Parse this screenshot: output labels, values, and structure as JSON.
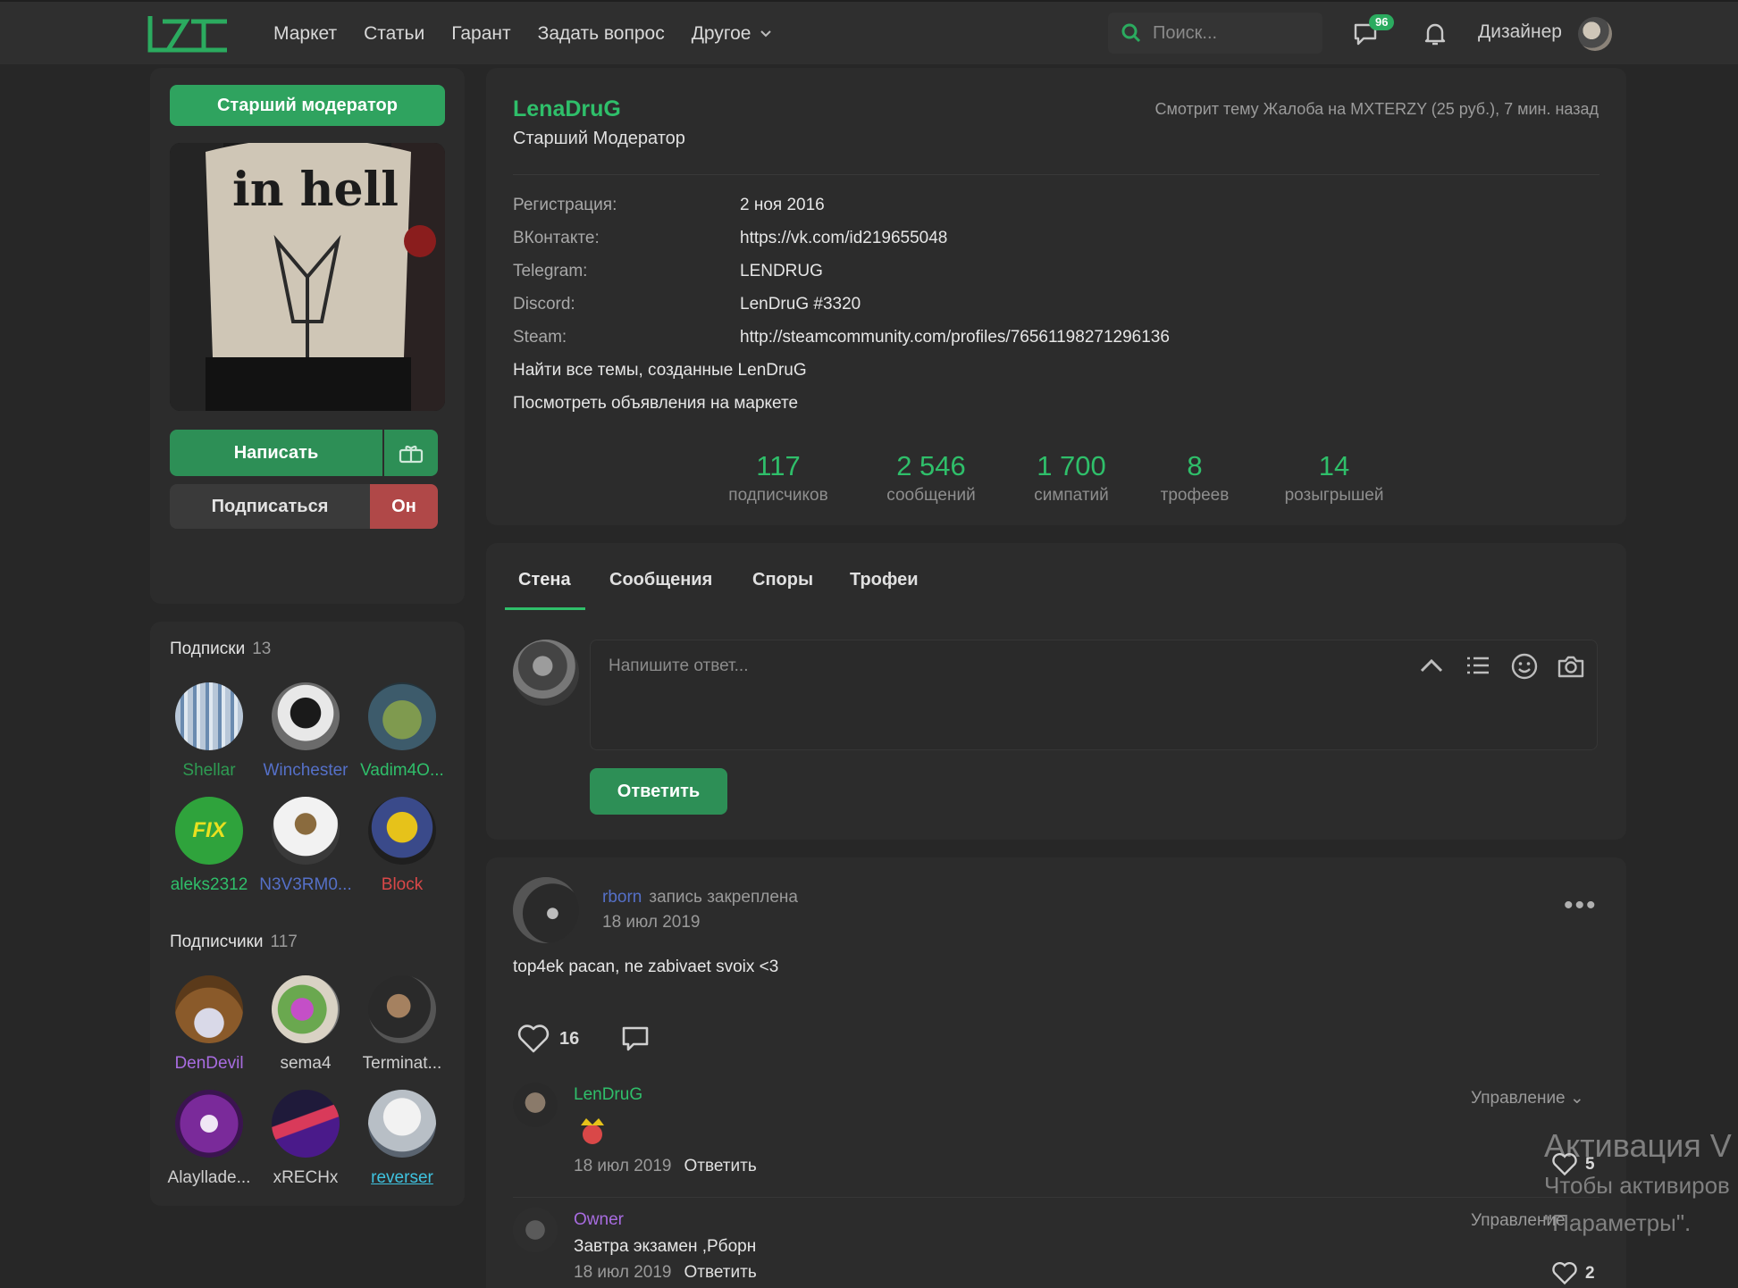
{
  "nav": {
    "links": [
      "Маркет",
      "Статьи",
      "Гарант",
      "Задать вопрос",
      "Другое"
    ],
    "search_placeholder": "Поиск...",
    "messages_badge": "96",
    "user_name": "Дизайнер",
    "colors": {
      "accent": "#2fbf6a",
      "bg": "#272727",
      "panel": "#2c2c2c"
    }
  },
  "sidebar": {
    "role_badge": "Старший модератор",
    "write_label": "Написать",
    "follow_label": "Подписаться",
    "gender_label": "Он",
    "subscriptions": {
      "title": "Подписки",
      "count": "13",
      "users": [
        {
          "name": "Shellar",
          "color": "#2e9b52"
        },
        {
          "name": "Winchester",
          "color": "#5570c8"
        },
        {
          "name": "Vadim4O...",
          "color": "#2fbf6a"
        },
        {
          "name": "aleks2312",
          "color": "#2fbf6a"
        },
        {
          "name": "N3V3RM0...",
          "color": "#5570c8"
        },
        {
          "name": "Block",
          "color": "#d94848"
        }
      ]
    },
    "followers": {
      "title": "Подписчики",
      "count": "117",
      "users": [
        {
          "name": "DenDevil",
          "color": "#a86ce0"
        },
        {
          "name": "sema4",
          "color": "#cfcfcf"
        },
        {
          "name": "Terminat...",
          "color": "#cfcfcf"
        },
        {
          "name": "Alaylladе...",
          "color": "#cfcfcf"
        },
        {
          "name": "xRECHx",
          "color": "#cfcfcf"
        },
        {
          "name": "reverser",
          "color": "#3fc3e0"
        }
      ]
    }
  },
  "profile": {
    "name": "LenaDruG",
    "role": "Старший Модератор",
    "status": "Смотрит тему Жалоба на MXTERZY (25 руб.), 7 мин. назад",
    "info": [
      {
        "label": "Регистрация:",
        "value": "2 ноя 2016"
      },
      {
        "label": "ВКонтакте:",
        "value": "https://vk.com/id219655048"
      },
      {
        "label": "Telegram:",
        "value": "LENDRUG"
      },
      {
        "label": "Discord:",
        "value": "LenDruG #3320"
      },
      {
        "label": "Steam:",
        "value": "http://steamcommunity.com/profiles/76561198271296136"
      }
    ],
    "links": [
      "Найти все темы, созданные LenDruG",
      "Посмотреть объявления на маркете"
    ],
    "stats": [
      {
        "value": "117",
        "label": "подписчиков"
      },
      {
        "value": "2 546",
        "label": "сообщений"
      },
      {
        "value": "1 700",
        "label": "симпатий"
      },
      {
        "value": "8",
        "label": "трофеев"
      },
      {
        "value": "14",
        "label": "розыгрышей"
      }
    ]
  },
  "tabs": [
    "Стена",
    "Сообщения",
    "Споры",
    "Трофеи"
  ],
  "reply": {
    "placeholder": "Напишите ответ...",
    "button": "Ответить"
  },
  "post": {
    "author": "rborn",
    "action": "запись закреплена",
    "date": "18 июл 2019",
    "text": "top4ek pacan, ne zabivaet svoix <3",
    "likes": "16",
    "comments": [
      {
        "author": "LenDruG",
        "date": "18 июл 2019",
        "reply": "Ответить",
        "manage": "Управление",
        "likes": "5",
        "text": ""
      },
      {
        "author": "Owner",
        "date": "18 июл 2019",
        "reply": "Ответить",
        "manage": "Управление",
        "likes": "2",
        "text": "Завтра экзамен ,Рборн"
      }
    ]
  },
  "watermark": {
    "line1": "Активация V",
    "line2": "Чтобы активиров",
    "line3": "\"Параметры\"."
  }
}
